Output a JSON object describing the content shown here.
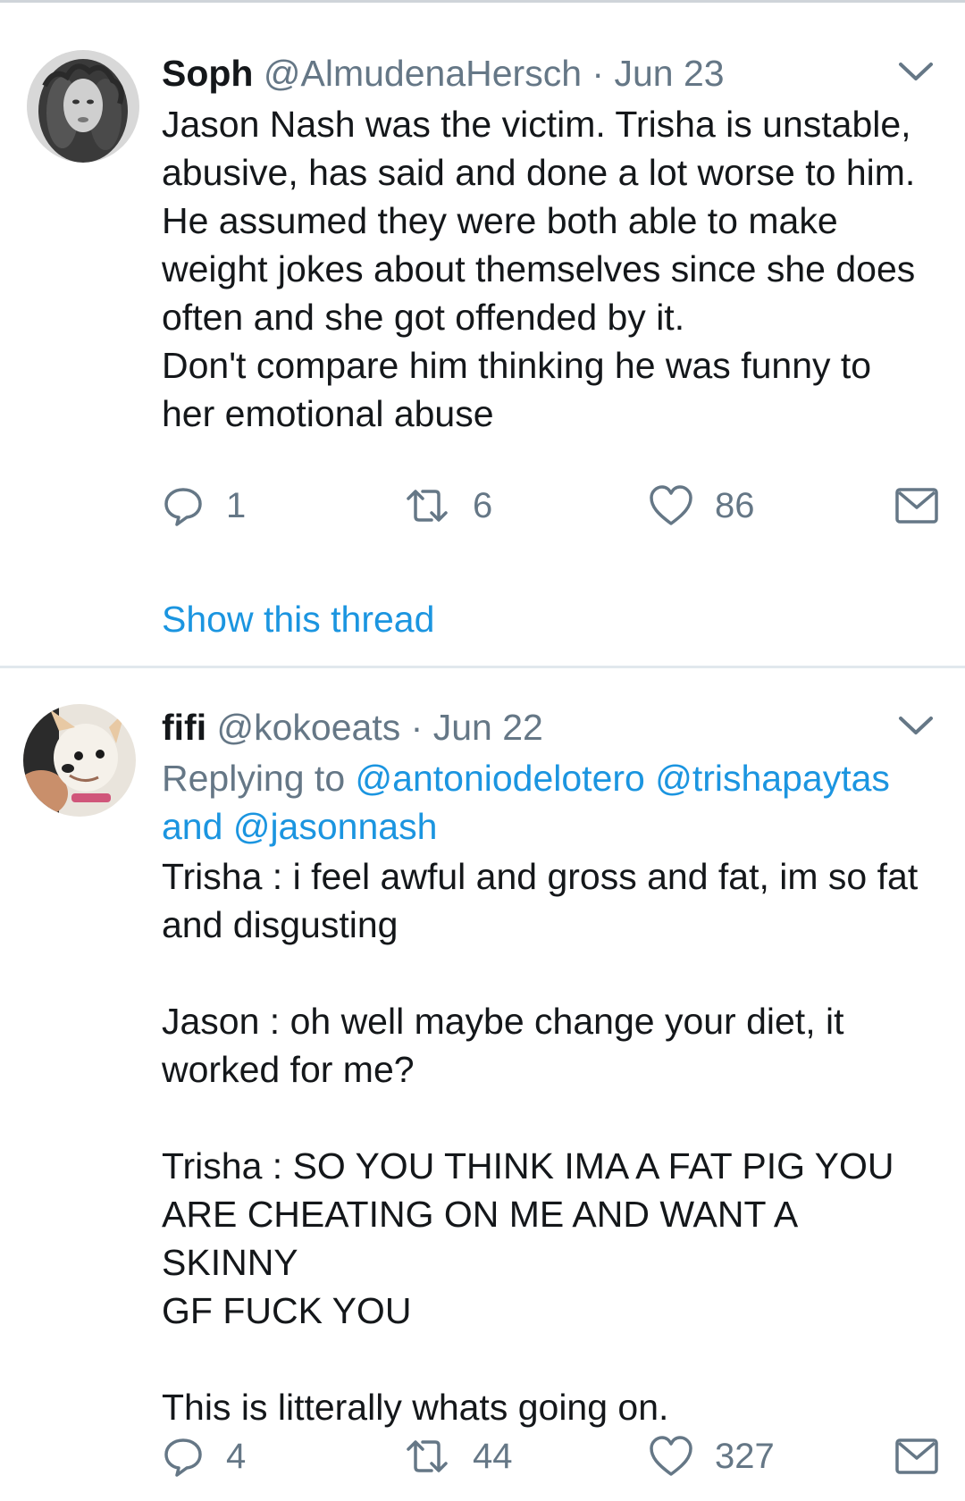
{
  "colors": {
    "link": "#1b95e0",
    "secondary_text": "#657786",
    "primary_text": "#14171a",
    "divider": "#e1e8ed"
  },
  "tweets": [
    {
      "name": "Soph",
      "handle": "@AlmudenaHersch",
      "separator": "·",
      "date": "Jun 23",
      "avatar_icon": "profile-photo-curly-hair",
      "menu_icon": "chevron-down-icon",
      "text": "Jason Nash was the victim. Trisha is unstable,\nabusive, has said and done a lot worse to him.\nHe assumed they were both able to make\nweight jokes about themselves since she does\noften and she got offended by it.\nDon't compare him thinking he was funny to\nher emotional abuse",
      "replies": "1",
      "retweets": "6",
      "likes": "86",
      "show_thread": "Show this thread"
    },
    {
      "name": "fifi",
      "handle": "@kokoeats",
      "separator": "·",
      "date": "Jun 22",
      "avatar_icon": "profile-photo-chihuahua",
      "menu_icon": "chevron-down-icon",
      "replying_prefix": "Replying to",
      "replying_mention_1": "@antoniodelotero",
      "replying_mention_2": "@trishapaytas",
      "replying_and": "and",
      "replying_mention_3": "@jasonnash",
      "text": "Trisha : i feel awful and gross and fat, im so fat\nand disgusting\n\nJason : oh well maybe change your diet, it\nworked for me?\n\nTrisha : SO YOU THINK IMA A FAT PIG YOU\nARE CHEATING ON ME AND WANT A SKINNY\nGF FUCK YOU\n\nThis is litterally whats going on.",
      "replies": "4",
      "retweets": "44",
      "likes": "327"
    }
  ]
}
